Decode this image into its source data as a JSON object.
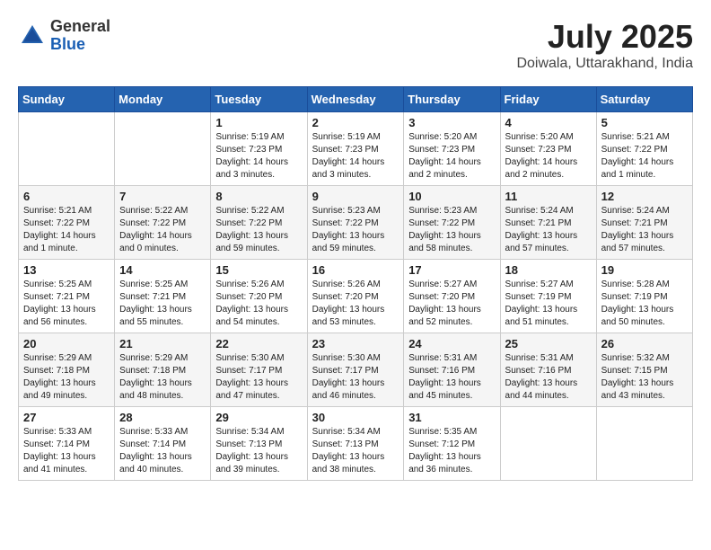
{
  "header": {
    "logo_general": "General",
    "logo_blue": "Blue",
    "month_year": "July 2025",
    "location": "Doiwala, Uttarakhand, India"
  },
  "days_of_week": [
    "Sunday",
    "Monday",
    "Tuesday",
    "Wednesday",
    "Thursday",
    "Friday",
    "Saturday"
  ],
  "weeks": [
    [
      {
        "day": "",
        "info": ""
      },
      {
        "day": "",
        "info": ""
      },
      {
        "day": "1",
        "info": "Sunrise: 5:19 AM\nSunset: 7:23 PM\nDaylight: 14 hours\nand 3 minutes."
      },
      {
        "day": "2",
        "info": "Sunrise: 5:19 AM\nSunset: 7:23 PM\nDaylight: 14 hours\nand 3 minutes."
      },
      {
        "day": "3",
        "info": "Sunrise: 5:20 AM\nSunset: 7:23 PM\nDaylight: 14 hours\nand 2 minutes."
      },
      {
        "day": "4",
        "info": "Sunrise: 5:20 AM\nSunset: 7:23 PM\nDaylight: 14 hours\nand 2 minutes."
      },
      {
        "day": "5",
        "info": "Sunrise: 5:21 AM\nSunset: 7:22 PM\nDaylight: 14 hours\nand 1 minute."
      }
    ],
    [
      {
        "day": "6",
        "info": "Sunrise: 5:21 AM\nSunset: 7:22 PM\nDaylight: 14 hours\nand 1 minute."
      },
      {
        "day": "7",
        "info": "Sunrise: 5:22 AM\nSunset: 7:22 PM\nDaylight: 14 hours\nand 0 minutes."
      },
      {
        "day": "8",
        "info": "Sunrise: 5:22 AM\nSunset: 7:22 PM\nDaylight: 13 hours\nand 59 minutes."
      },
      {
        "day": "9",
        "info": "Sunrise: 5:23 AM\nSunset: 7:22 PM\nDaylight: 13 hours\nand 59 minutes."
      },
      {
        "day": "10",
        "info": "Sunrise: 5:23 AM\nSunset: 7:22 PM\nDaylight: 13 hours\nand 58 minutes."
      },
      {
        "day": "11",
        "info": "Sunrise: 5:24 AM\nSunset: 7:21 PM\nDaylight: 13 hours\nand 57 minutes."
      },
      {
        "day": "12",
        "info": "Sunrise: 5:24 AM\nSunset: 7:21 PM\nDaylight: 13 hours\nand 57 minutes."
      }
    ],
    [
      {
        "day": "13",
        "info": "Sunrise: 5:25 AM\nSunset: 7:21 PM\nDaylight: 13 hours\nand 56 minutes."
      },
      {
        "day": "14",
        "info": "Sunrise: 5:25 AM\nSunset: 7:21 PM\nDaylight: 13 hours\nand 55 minutes."
      },
      {
        "day": "15",
        "info": "Sunrise: 5:26 AM\nSunset: 7:20 PM\nDaylight: 13 hours\nand 54 minutes."
      },
      {
        "day": "16",
        "info": "Sunrise: 5:26 AM\nSunset: 7:20 PM\nDaylight: 13 hours\nand 53 minutes."
      },
      {
        "day": "17",
        "info": "Sunrise: 5:27 AM\nSunset: 7:20 PM\nDaylight: 13 hours\nand 52 minutes."
      },
      {
        "day": "18",
        "info": "Sunrise: 5:27 AM\nSunset: 7:19 PM\nDaylight: 13 hours\nand 51 minutes."
      },
      {
        "day": "19",
        "info": "Sunrise: 5:28 AM\nSunset: 7:19 PM\nDaylight: 13 hours\nand 50 minutes."
      }
    ],
    [
      {
        "day": "20",
        "info": "Sunrise: 5:29 AM\nSunset: 7:18 PM\nDaylight: 13 hours\nand 49 minutes."
      },
      {
        "day": "21",
        "info": "Sunrise: 5:29 AM\nSunset: 7:18 PM\nDaylight: 13 hours\nand 48 minutes."
      },
      {
        "day": "22",
        "info": "Sunrise: 5:30 AM\nSunset: 7:17 PM\nDaylight: 13 hours\nand 47 minutes."
      },
      {
        "day": "23",
        "info": "Sunrise: 5:30 AM\nSunset: 7:17 PM\nDaylight: 13 hours\nand 46 minutes."
      },
      {
        "day": "24",
        "info": "Sunrise: 5:31 AM\nSunset: 7:16 PM\nDaylight: 13 hours\nand 45 minutes."
      },
      {
        "day": "25",
        "info": "Sunrise: 5:31 AM\nSunset: 7:16 PM\nDaylight: 13 hours\nand 44 minutes."
      },
      {
        "day": "26",
        "info": "Sunrise: 5:32 AM\nSunset: 7:15 PM\nDaylight: 13 hours\nand 43 minutes."
      }
    ],
    [
      {
        "day": "27",
        "info": "Sunrise: 5:33 AM\nSunset: 7:14 PM\nDaylight: 13 hours\nand 41 minutes."
      },
      {
        "day": "28",
        "info": "Sunrise: 5:33 AM\nSunset: 7:14 PM\nDaylight: 13 hours\nand 40 minutes."
      },
      {
        "day": "29",
        "info": "Sunrise: 5:34 AM\nSunset: 7:13 PM\nDaylight: 13 hours\nand 39 minutes."
      },
      {
        "day": "30",
        "info": "Sunrise: 5:34 AM\nSunset: 7:13 PM\nDaylight: 13 hours\nand 38 minutes."
      },
      {
        "day": "31",
        "info": "Sunrise: 5:35 AM\nSunset: 7:12 PM\nDaylight: 13 hours\nand 36 minutes."
      },
      {
        "day": "",
        "info": ""
      },
      {
        "day": "",
        "info": ""
      }
    ]
  ]
}
